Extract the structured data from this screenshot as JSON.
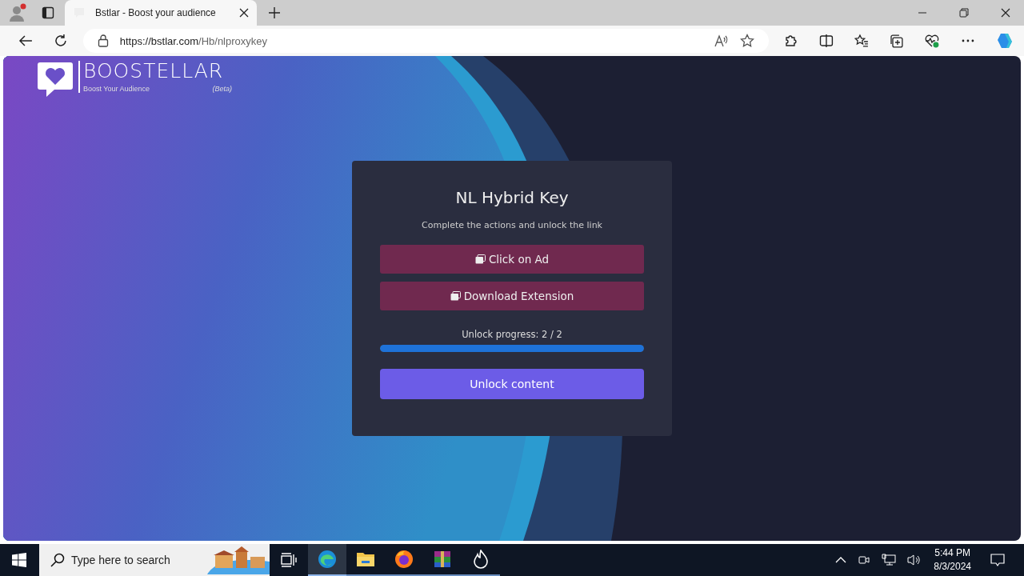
{
  "browser": {
    "tab_title": "Bstlar - Boost your audience",
    "url_host": "https://bstlar.com",
    "url_path": "/Hb/nlproxykey"
  },
  "logo": {
    "name": "BOOSTELLAR",
    "tagline": "Boost Your Audience",
    "badge": "(Beta)"
  },
  "card": {
    "title": "NL Hybrid Key",
    "subtitle": "Complete the actions and unlock the link",
    "actions": [
      {
        "label": "Click on Ad"
      },
      {
        "label": "Download Extension"
      }
    ],
    "progress": {
      "label": "Unlock progress: 2 / 2",
      "level": 1
    },
    "unlock_button": "Unlock content"
  },
  "taskbar": {
    "search_placeholder": "Type here to search",
    "time": "5:44 PM",
    "date": "8/3/2024",
    "apps": [
      {
        "kind": "edge",
        "selected": true
      },
      {
        "kind": "folder",
        "selected": false
      },
      {
        "kind": "firefox",
        "selected": false
      },
      {
        "kind": "archive",
        "selected": false
      },
      {
        "kind": "flame",
        "selected": false
      }
    ]
  }
}
